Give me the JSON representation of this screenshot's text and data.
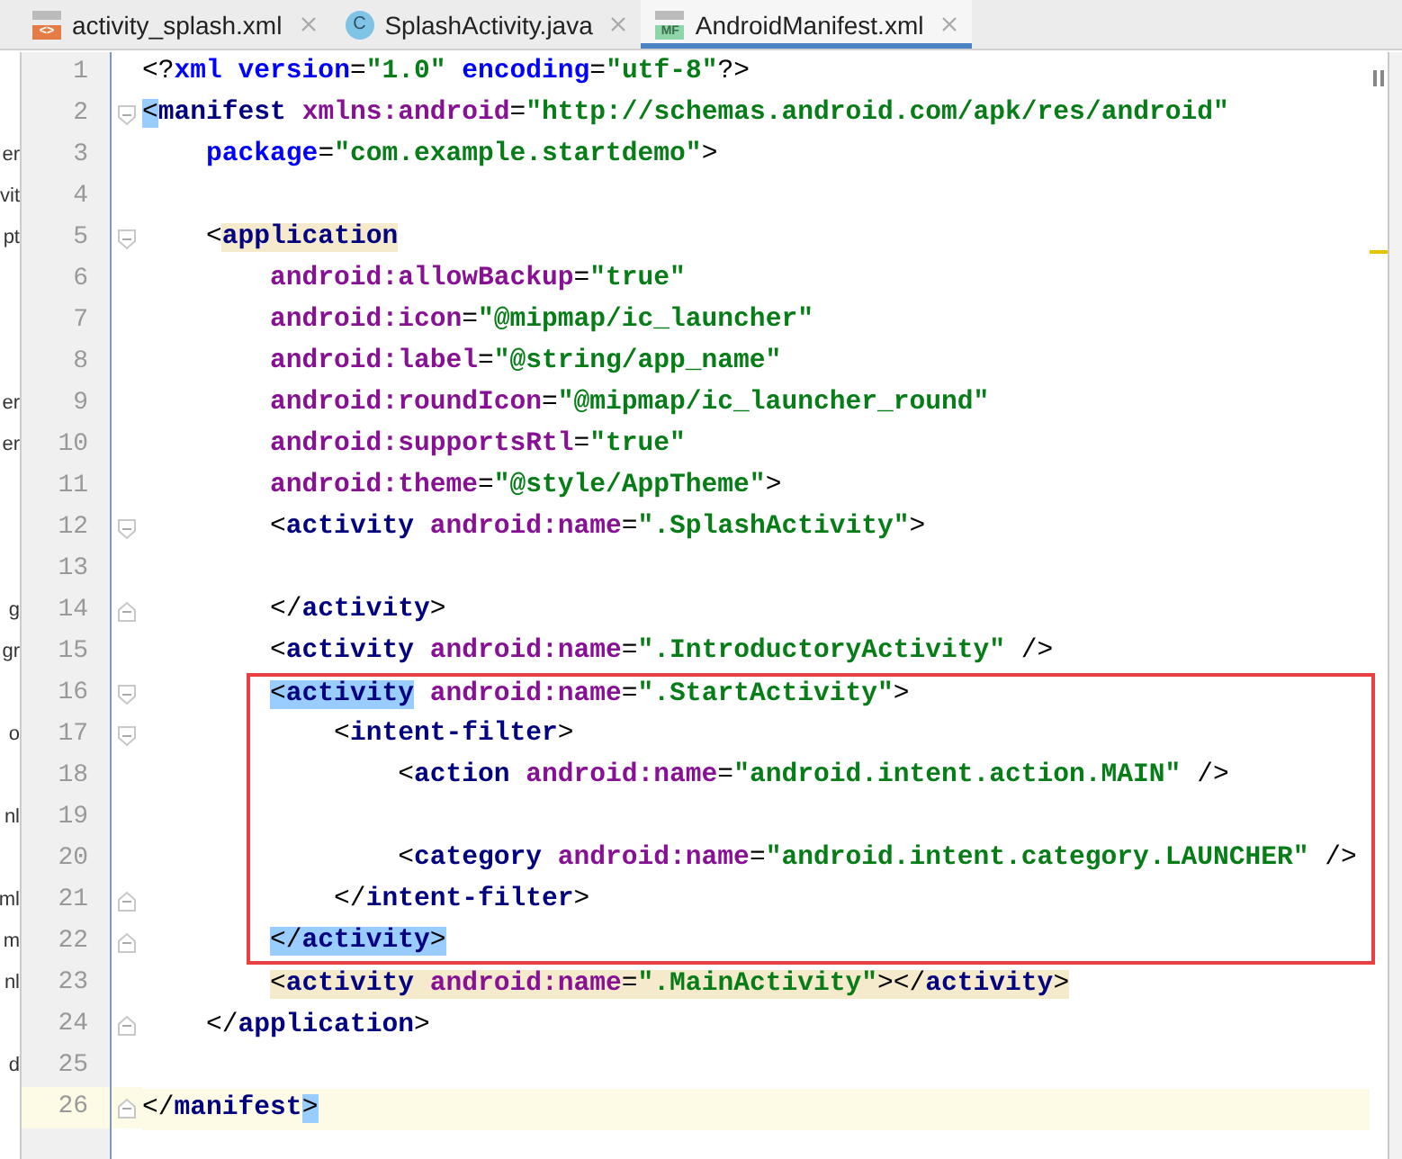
{
  "tabs": [
    {
      "label": "activity_splash.xml",
      "kind": "xml",
      "icon_label": "<>",
      "selected": false
    },
    {
      "label": "SplashActivity.java",
      "kind": "class",
      "icon_label": "C",
      "selected": false
    },
    {
      "label": "AndroidManifest.xml",
      "kind": "manifest",
      "icon_label": "MF",
      "selected": true
    }
  ],
  "editor": {
    "lines": [
      {
        "number": "1",
        "kind": "plain",
        "tokens": [
          {
            "kind": "punct",
            "text": "<?"
          },
          {
            "kind": "decl",
            "text": "xml"
          },
          {
            "kind": "decl",
            "text": " version"
          },
          {
            "kind": "punct",
            "text": "="
          },
          {
            "kind": "value",
            "text": "\"1.0\""
          },
          {
            "kind": "decl",
            "text": " encoding"
          },
          {
            "kind": "punct",
            "text": "="
          },
          {
            "kind": "value",
            "text": "\"utf-8\""
          },
          {
            "kind": "punct",
            "text": "?>"
          }
        ]
      },
      {
        "number": "2",
        "kind": "open",
        "tokens": [
          {
            "kind": "punct",
            "text": "<",
            "matched": true
          },
          {
            "kind": "tag",
            "text": "manifest"
          },
          {
            "kind": "attr",
            "text": " xmlns:android"
          },
          {
            "kind": "punct",
            "text": "="
          },
          {
            "kind": "value",
            "text": "\"http://schemas.android.com/apk/res/android\""
          }
        ],
        "children": [
          {
            "number": "3",
            "kind": "plain",
            "side": "er",
            "tokens": [
              {
                "kind": "decl",
                "text": "package"
              },
              {
                "kind": "punct",
                "text": "="
              },
              {
                "kind": "value",
                "text": "\"com.example.startdemo\""
              },
              {
                "kind": "punct",
                "text": ">"
              }
            ]
          },
          {
            "number": "4",
            "kind": "plain",
            "side": "vit"
          },
          {
            "number": "5",
            "kind": "open",
            "side": "pt",
            "tokens": [
              {
                "kind": "punct",
                "text": "<"
              },
              {
                "kind": "tag",
                "text": "application",
                "marked": true
              }
            ],
            "children": [
              {
                "number": "6",
                "kind": "plain",
                "tokens": [
                  {
                    "kind": "attr",
                    "text": "android:allowBackup"
                  },
                  {
                    "kind": "punct",
                    "text": "="
                  },
                  {
                    "kind": "value",
                    "text": "\"true\""
                  }
                ]
              },
              {
                "number": "7",
                "kind": "plain",
                "tokens": [
                  {
                    "kind": "attr",
                    "text": "android:icon"
                  },
                  {
                    "kind": "punct",
                    "text": "="
                  },
                  {
                    "kind": "value",
                    "text": "\"@mipmap/ic_launcher\""
                  }
                ]
              },
              {
                "number": "8",
                "kind": "plain",
                "tokens": [
                  {
                    "kind": "attr",
                    "text": "android:label"
                  },
                  {
                    "kind": "punct",
                    "text": "="
                  },
                  {
                    "kind": "value",
                    "text": "\"@string/app_name\""
                  }
                ]
              },
              {
                "number": "9",
                "kind": "plain",
                "side": "er",
                "tokens": [
                  {
                    "kind": "attr",
                    "text": "android:roundIcon"
                  },
                  {
                    "kind": "punct",
                    "text": "="
                  },
                  {
                    "kind": "value",
                    "text": "\"@mipmap/ic_launcher_round\""
                  }
                ]
              },
              {
                "number": "10",
                "kind": "plain",
                "side": "er",
                "tokens": [
                  {
                    "kind": "attr",
                    "text": "android:supportsRtl"
                  },
                  {
                    "kind": "punct",
                    "text": "="
                  },
                  {
                    "kind": "value",
                    "text": "\"true\""
                  }
                ]
              },
              {
                "number": "11",
                "kind": "plain",
                "tokens": [
                  {
                    "kind": "attr",
                    "text": "android:theme"
                  },
                  {
                    "kind": "punct",
                    "text": "="
                  },
                  {
                    "kind": "value",
                    "text": "\"@style/AppTheme\""
                  },
                  {
                    "kind": "punct",
                    "text": ">"
                  }
                ]
              },
              {
                "number": "12",
                "kind": "open",
                "tokens": [
                  {
                    "kind": "punct",
                    "text": "<"
                  },
                  {
                    "kind": "tag",
                    "text": "activity"
                  },
                  {
                    "kind": "attr",
                    "text": " android:name"
                  },
                  {
                    "kind": "punct",
                    "text": "="
                  },
                  {
                    "kind": "value",
                    "text": "\".SplashActivity\""
                  },
                  {
                    "kind": "punct",
                    "text": ">"
                  }
                ]
              },
              {
                "number": "13",
                "kind": "plain"
              },
              {
                "number": "14",
                "kind": "close",
                "side": "g",
                "tokens": [
                  {
                    "kind": "punct",
                    "text": "</"
                  },
                  {
                    "kind": "tag",
                    "text": "activity"
                  },
                  {
                    "kind": "punct",
                    "text": ">"
                  }
                ]
              },
              {
                "number": "15",
                "kind": "plain",
                "side": "gr",
                "tokens": [
                  {
                    "kind": "punct",
                    "text": "<"
                  },
                  {
                    "kind": "tag",
                    "text": "activity"
                  },
                  {
                    "kind": "attr",
                    "text": " android:name"
                  },
                  {
                    "kind": "punct",
                    "text": "="
                  },
                  {
                    "kind": "value",
                    "text": "\".IntroductoryActivity\""
                  },
                  {
                    "kind": "punct",
                    "text": " />"
                  }
                ]
              },
              {
                "number": "16",
                "kind": "open",
                "boxed": true,
                "tokens": [
                  {
                    "kind": "punct",
                    "text": "<",
                    "matched": true
                  },
                  {
                    "kind": "tag",
                    "text": "activity",
                    "matched": true
                  },
                  {
                    "kind": "attr",
                    "text": " android:name"
                  },
                  {
                    "kind": "punct",
                    "text": "="
                  },
                  {
                    "kind": "value",
                    "text": "\".StartActivity\""
                  },
                  {
                    "kind": "punct",
                    "text": ">"
                  }
                ],
                "children": [
                  {
                    "number": "17",
                    "kind": "open",
                    "side": "o",
                    "boxed": true,
                    "tokens": [
                      {
                        "kind": "punct",
                        "text": "<"
                      },
                      {
                        "kind": "tag",
                        "text": "intent-filter"
                      },
                      {
                        "kind": "punct",
                        "text": ">"
                      }
                    ],
                    "children": [
                      {
                        "number": "18",
                        "boxed": true,
                        "tokens": [
                          {
                            "kind": "punct",
                            "text": "<"
                          },
                          {
                            "kind": "tag",
                            "text": "action"
                          },
                          {
                            "kind": "attr",
                            "text": " android:name"
                          },
                          {
                            "kind": "punct",
                            "text": "="
                          },
                          {
                            "kind": "value",
                            "text": "\"android.intent.action.MAIN\""
                          },
                          {
                            "kind": "punct",
                            "text": " />"
                          }
                        ]
                      },
                      {
                        "number": "19",
                        "side": "nl",
                        "boxed": true
                      },
                      {
                        "number": "20",
                        "boxed": true,
                        "tokens": [
                          {
                            "kind": "punct",
                            "text": "<"
                          },
                          {
                            "kind": "tag",
                            "text": "category"
                          },
                          {
                            "kind": "attr",
                            "text": " android:name"
                          },
                          {
                            "kind": "punct",
                            "text": "="
                          },
                          {
                            "kind": "value",
                            "text": "\"android.intent.category.LAUNCHER\""
                          },
                          {
                            "kind": "punct",
                            "text": " />"
                          }
                        ]
                      }
                    ]
                  },
                  {
                    "number": "21",
                    "kind": "close",
                    "side": "ml",
                    "boxed": true,
                    "tokens": [
                      {
                        "kind": "punct",
                        "text": "</"
                      },
                      {
                        "kind": "tag",
                        "text": "intent-filter"
                      },
                      {
                        "kind": "punct",
                        "text": ">"
                      }
                    ]
                  }
                ]
              },
              {
                "number": "22",
                "kind": "close",
                "side": "m",
                "boxed": true,
                "tokens": [
                  {
                    "kind": "punct",
                    "text": "</",
                    "matched": true
                  },
                  {
                    "kind": "tag",
                    "text": "activity",
                    "matched": true
                  },
                  {
                    "kind": "punct",
                    "text": ">",
                    "matched": true
                  }
                ]
              },
              {
                "number": "23",
                "kind": "plain",
                "side": "nl",
                "tokens": [
                  {
                    "kind": "punct",
                    "text": "<",
                    "marked": true
                  },
                  {
                    "kind": "tag",
                    "text": "activity",
                    "marked": true
                  },
                  {
                    "kind": "attr",
                    "text": " android:name",
                    "marked": true
                  },
                  {
                    "kind": "punct",
                    "text": "=",
                    "marked": true
                  },
                  {
                    "kind": "value",
                    "text": "\".MainActivity\"",
                    "marked": true
                  },
                  {
                    "kind": "punct",
                    "text": "></",
                    "marked": true
                  },
                  {
                    "kind": "tag",
                    "text": "activity",
                    "marked": true
                  },
                  {
                    "kind": "punct",
                    "text": ">",
                    "marked": true
                  }
                ]
              }
            ]
          },
          {
            "number": "24",
            "kind": "close",
            "tokens": [
              {
                "kind": "punct",
                "text": "</"
              },
              {
                "kind": "tag",
                "text": "application"
              },
              {
                "kind": "punct",
                "text": ">"
              }
            ]
          },
          {
            "number": "25",
            "kind": "plain",
            "side": "d"
          }
        ]
      },
      {
        "number": "26",
        "kind": "close",
        "current": true,
        "tokens": [
          {
            "kind": "punct",
            "text": "</"
          },
          {
            "kind": "tag",
            "text": "manifest"
          },
          {
            "kind": "punct",
            "text": ">",
            "matched": true
          }
        ]
      }
    ]
  }
}
